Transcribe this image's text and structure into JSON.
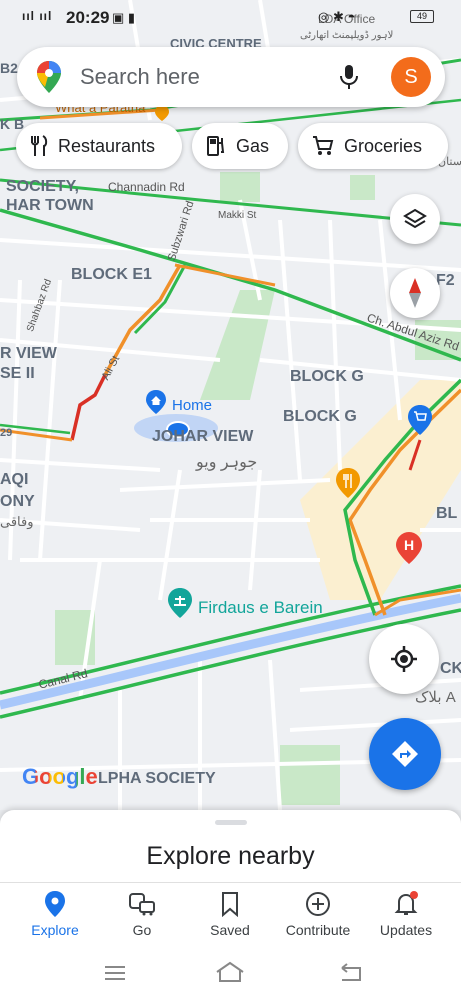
{
  "status_bar": {
    "carrier_glyphs": "ııl ııl",
    "time": "20:29",
    "battery": "49"
  },
  "search": {
    "placeholder": "Search here",
    "avatar_letter": "S"
  },
  "chips": [
    {
      "label": "Restaurants",
      "icon": "fork-knife-icon"
    },
    {
      "label": "Gas",
      "icon": "gas-pump-icon"
    },
    {
      "label": "Groceries",
      "icon": "cart-icon"
    }
  ],
  "map": {
    "labels": {
      "civic_centre": "CIVIC CENTRE",
      "lda_office": "LDA Office",
      "lda_urdu": "لاہور ڈویلپمنٹ اتھارٹی",
      "what_a_paratha": "What a Paratha",
      "society": "SOCIETY,",
      "har_town": "HAR TOWN",
      "channadin_rd": "Channadin Rd",
      "makki_st": "Makki St",
      "subzwari_rd": "Subzwari Rd",
      "block_e1": "BLOCK E1",
      "block_f2": "K F2",
      "ch_abdul_aziz": "Ch. Abdul Aziz Rd",
      "shahbaz_rd": "Shahbaz Rd",
      "r_view": "R VIEW",
      "se_ii": "SE II",
      "ali_st": "Ali St",
      "block_g1": "BLOCK G",
      "block_g2": "BLOCK G",
      "home": "Home",
      "johar_view": "JOHAR VIEW",
      "johar_view_urdu": "جوہر ویو",
      "aqi": "AQI",
      "ony": "ONY",
      "wafaqi_urdu": "وفاقی",
      "bl": "BL",
      "firdaus": "Firdaus e Barein",
      "canal_rd": "Canal Rd",
      "ck": "CK",
      "a_urdu": "بلاک A",
      "alpha_society": "LPHA SOCIETY",
      "left_29": "29",
      "left_b2": "B2",
      "left_kb": "K B",
      "google": "Google",
      "stan": "ستان"
    },
    "colors": {
      "traffic_green": "#2fb84e",
      "traffic_orange": "#f0902a",
      "traffic_red": "#d93025",
      "water": "#a8c7fa",
      "park": "#c9e8c8"
    }
  },
  "buttons": {
    "layers": "layers-icon",
    "compass": "compass-icon",
    "my_location": "my-location-icon",
    "directions": "directions-icon"
  },
  "sheet": {
    "title": "Explore nearby"
  },
  "bottom_nav": [
    {
      "label": "Explore",
      "icon": "pin-icon",
      "active": true
    },
    {
      "label": "Go",
      "icon": "commute-icon"
    },
    {
      "label": "Saved",
      "icon": "bookmark-icon"
    },
    {
      "label": "Contribute",
      "icon": "add-circle-icon"
    },
    {
      "label": "Updates",
      "icon": "bell-icon"
    }
  ]
}
